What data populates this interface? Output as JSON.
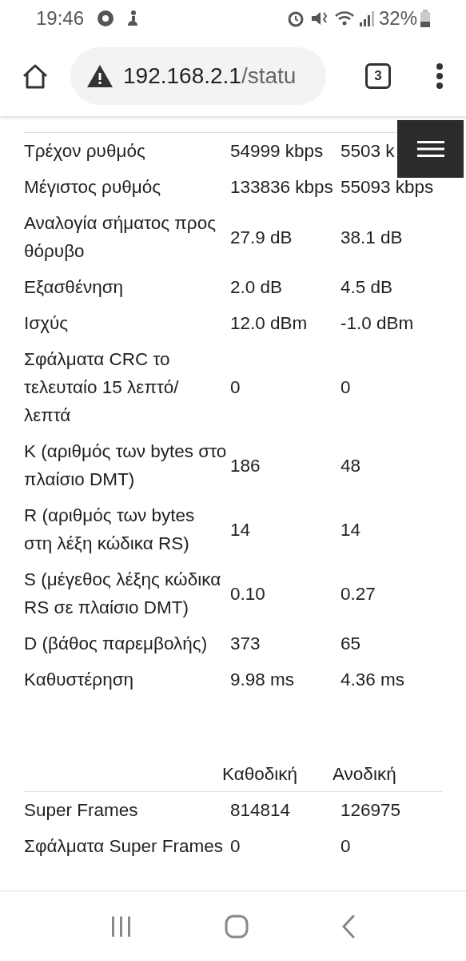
{
  "status_bar": {
    "time": "19:46",
    "battery": "32%"
  },
  "browser": {
    "url_host": "192.168.2.1",
    "url_path": "/statu",
    "tab_count": "3"
  },
  "tables": [
    {
      "rows": [
        {
          "label": "Τρέχον ρυθμός",
          "downstream": "54999 kbps",
          "upstream": "5503 k"
        },
        {
          "label": "Μέγιστος ρυθμός",
          "downstream": "133836 kbps",
          "upstream": "55093 kbps"
        },
        {
          "label": "Αναλογία σήματος προς θόρυβο",
          "downstream": "27.9 dB",
          "upstream": "38.1 dB"
        },
        {
          "label": "Εξασθένηση",
          "downstream": "2.0 dB",
          "upstream": "4.5 dB"
        },
        {
          "label": "Ισχύς",
          "downstream": "12.0 dBm",
          "upstream": "-1.0 dBm"
        },
        {
          "label": "Σφάλματα CRC το τελευταίο 15 λεπτό/ λεπτά",
          "downstream": "0",
          "upstream": "0"
        },
        {
          "label": "K (αριθμός των bytes στο πλαίσιο DMT)",
          "downstream": "186",
          "upstream": "48"
        },
        {
          "label": "R (αριθμός των bytes στη λέξη κώδικα RS)",
          "downstream": "14",
          "upstream": "14"
        },
        {
          "label": "S (μέγεθος λέξης κώδικα RS σε πλαίσιο DMT)",
          "downstream": "0.10",
          "upstream": "0.27"
        },
        {
          "label": "D (βάθος παρεμβολής)",
          "downstream": "373",
          "upstream": "65"
        },
        {
          "label": "Καθυστέρηση",
          "downstream": "9.98 ms",
          "upstream": "4.36 ms"
        }
      ]
    },
    {
      "columns": [
        "Καθοδική",
        "Ανοδική"
      ],
      "rows": [
        {
          "label": "Super Frames",
          "downstream": "814814",
          "upstream": "126975"
        },
        {
          "label": "Σφάλματα Super Frames",
          "downstream": "0",
          "upstream": "0"
        }
      ]
    }
  ]
}
